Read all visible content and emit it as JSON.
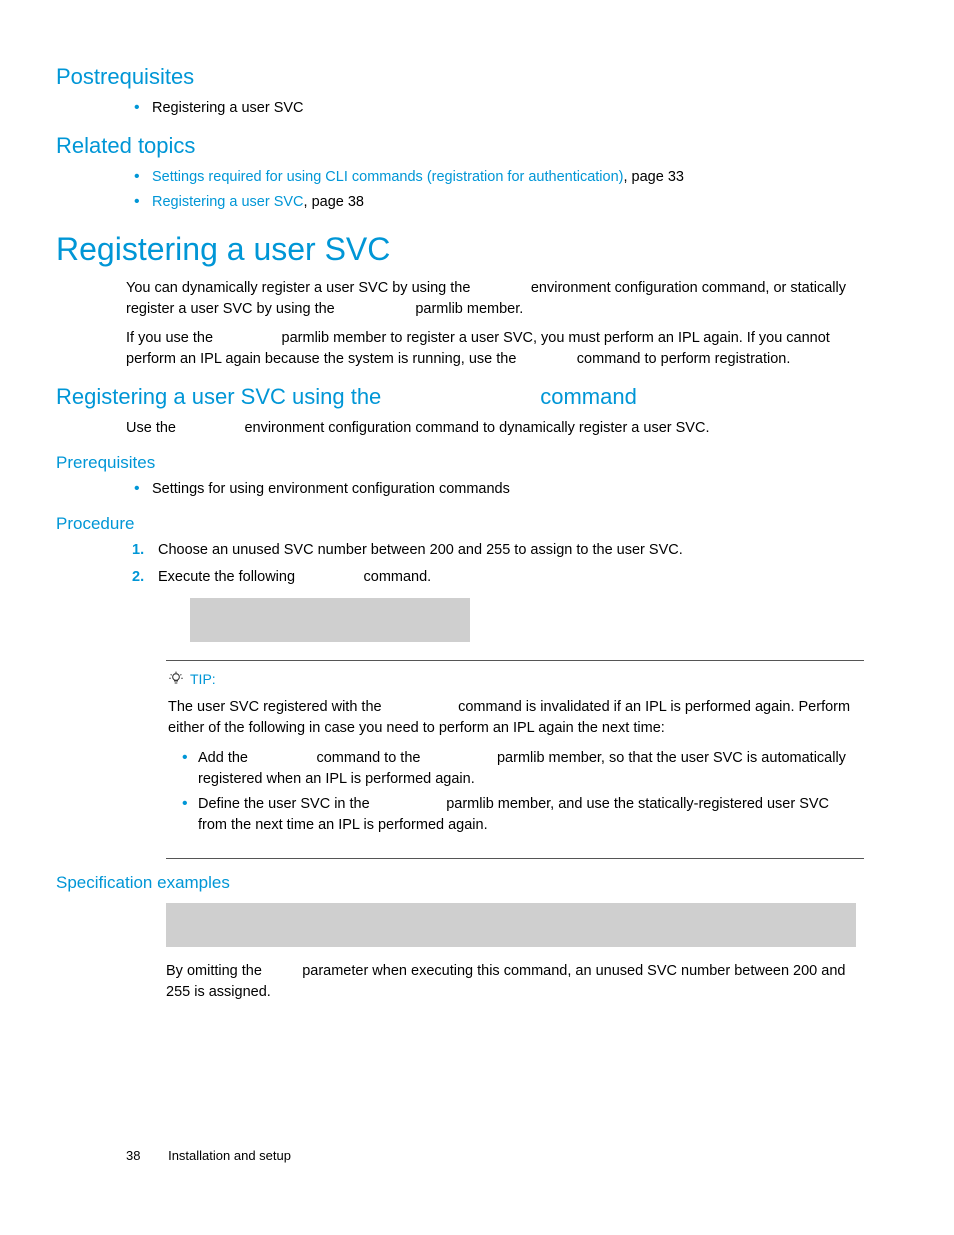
{
  "postrequisites": {
    "heading": "Postrequisites",
    "items": [
      "Registering a user SVC"
    ]
  },
  "related": {
    "heading": "Related topics",
    "items": [
      {
        "link": "Settings required for using CLI commands (registration for authentication)",
        "suffix": ", page 33"
      },
      {
        "link": "Registering a user SVC",
        "suffix": ", page 38"
      }
    ]
  },
  "main": {
    "heading": "Registering a user SVC",
    "p1": "You can dynamically register a user SVC by using the               environment configuration command, or statically register a user SVC by using the                    parmlib member.",
    "p2": "If you use the                 parmlib member to register a user SVC, you must perform an IPL again. If you cannot perform an IPL again because the system is running, use the               command to perform registration."
  },
  "sub": {
    "heading": "Registering a user SVC using the                          command",
    "p1": "Use the                 environment configuration command to dynamically register a user SVC."
  },
  "prereq": {
    "heading": "Prerequisites",
    "items": [
      "Settings for using environment configuration commands"
    ]
  },
  "procedure": {
    "heading": "Procedure",
    "steps": [
      "Choose an unused SVC number between 200 and 255 to assign to the user SVC.",
      "Execute the following                 command."
    ]
  },
  "tip": {
    "label": "TIP:",
    "p1": "The user SVC registered with the                   command is invalidated if an IPL is performed again. Perform either of the following in case you need to perform an IPL again the next time:",
    "items": [
      "Add the                 command to the                   parmlib member, so that the user SVC is automatically registered when an IPL is performed again.",
      "Define the user SVC in the                   parmlib member, and use the statically-registered user SVC from the next time an IPL is performed again."
    ]
  },
  "spec": {
    "heading": "Specification examples",
    "p1": "By omitting the          parameter when executing this command, an unused SVC number between 200 and 255 is assigned."
  },
  "footer": {
    "page": "38",
    "section": "Installation and setup"
  }
}
